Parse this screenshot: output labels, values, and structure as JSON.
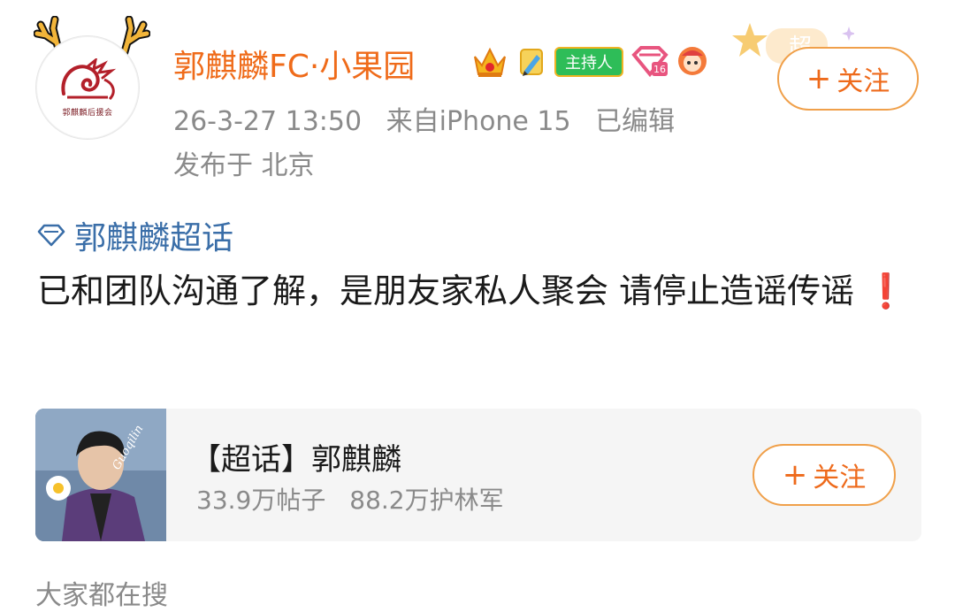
{
  "header": {
    "username": "郭麒麟FC·小果园",
    "host_badge": "主持人",
    "follow_label": "关注",
    "follow_plus": "+",
    "avatar_text": "郭麒麟后援会",
    "star_deco_text": "超"
  },
  "meta": {
    "date": "26-3-27 13:50",
    "source": "来自iPhone 15",
    "edited": "已编辑",
    "location": "发布于 北京"
  },
  "post": {
    "topic": "郭麒麟超话",
    "text": "已和团队沟通了解，是朋友家私人聚会 请停止造谣传谣",
    "emoji": "❗"
  },
  "card": {
    "title": "【超话】郭麒麟",
    "posts": "33.9万帖子",
    "members": "88.2万护林军",
    "follow_label": "关注",
    "follow_plus": "+",
    "photo_signature": "Guoqilin"
  },
  "bottom": {
    "label": "大家都在搜"
  },
  "colors": {
    "accent": "#ef6b1a",
    "topic": "#3a6ea8",
    "meta": "#8a8a8a",
    "host_badge": "#2ebd58"
  }
}
